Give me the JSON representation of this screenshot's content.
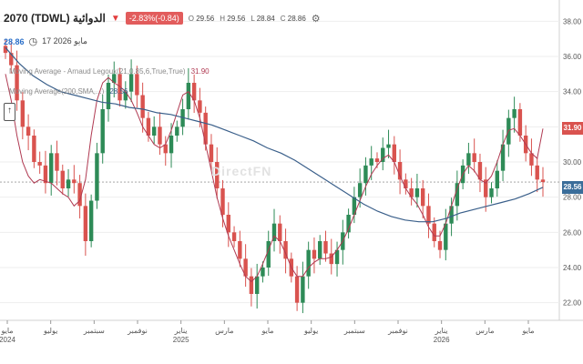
{
  "header": {
    "title": "2070 (TDWL) الدوائية",
    "change": "-2.83%(-0.84)",
    "ohlc": [
      {
        "key": "O",
        "value": "29.56"
      },
      {
        "key": "H",
        "value": "29.56"
      },
      {
        "key": "L",
        "value": "28.84"
      },
      {
        "key": "C",
        "value": "28.86"
      }
    ],
    "last_price": "28.86",
    "date": "17 2026 مايو"
  },
  "indicators": [
    {
      "label": "Moving Average - Arnaud Legoux(21,0.85,6,True,True)",
      "value": "31.90"
    },
    {
      "label": "Moving Average(200,SMA,...)",
      "value": "28.56"
    }
  ],
  "watermark": "DirectFN",
  "colors": {
    "up": "#2e8b57",
    "down": "#d9534f",
    "alma": "#b03a52",
    "sma": "#3a5f8a"
  },
  "chart_data": {
    "type": "candlestick",
    "title": "2070 (TDWL) الدوائية",
    "ylim": [
      21,
      39
    ],
    "y_ticks": [
      "22.00",
      "24.00",
      "26.00",
      "28.00",
      "30.00",
      "32.00",
      "34.00",
      "36.00",
      "38.00"
    ],
    "x_ticks": [
      "مايو 2024",
      "يوليو",
      "سبتمبر",
      "نوفمبر",
      "يناير 2025",
      "مارس",
      "مايو",
      "يوليو",
      "سبتمبر",
      "نوفمبر",
      "يناير 2026",
      "مارس",
      "مايو"
    ],
    "close_series": [
      36.2,
      35.5,
      33.5,
      32.0,
      31.5,
      30.0,
      29.8,
      28.8,
      30.5,
      29.5,
      28.5,
      29.0,
      28.8,
      27.5,
      25.5,
      27.8,
      30.5,
      33.0,
      34.5,
      35.0,
      33.5,
      34.0,
      35.0,
      33.8,
      32.5,
      31.5,
      32.0,
      31.0,
      30.5,
      31.5,
      32.0,
      33.0,
      34.5,
      33.5,
      32.8,
      31.0,
      30.0,
      28.5,
      27.0,
      26.0,
      25.5,
      24.5,
      23.5,
      22.5,
      23.5,
      24.0,
      25.5,
      26.5,
      25.5,
      24.5,
      23.5,
      22.0,
      23.5,
      25.0,
      24.5,
      25.5,
      24.8,
      24.2,
      25.0,
      26.0,
      27.0,
      28.0,
      28.8,
      29.8,
      30.2,
      30.0,
      30.8,
      31.0,
      30.0,
      29.0,
      28.5,
      28.0,
      28.5,
      27.5,
      26.5,
      25.5,
      25.0,
      26.5,
      27.5,
      28.8,
      29.8,
      30.5,
      30.0,
      29.0,
      28.0,
      28.5,
      29.5,
      31.0,
      32.5,
      33.0,
      31.5,
      30.5,
      29.8,
      29.0,
      28.86
    ],
    "alma_series": [
      35.0,
      33.5,
      31.5,
      30.0,
      29.2,
      28.8,
      29.0,
      28.9,
      28.8,
      28.5,
      28.2,
      28.0,
      27.5,
      27.8,
      29.0,
      31.5,
      33.5,
      34.5,
      34.8,
      34.5,
      34.3,
      34.0,
      33.5,
      32.8,
      32.0,
      31.5,
      31.0,
      30.8,
      31.0,
      31.8,
      32.8,
      33.8,
      34.0,
      33.5,
      32.5,
      31.0,
      29.5,
      28.0,
      26.8,
      25.8,
      25.0,
      24.2,
      23.5,
      23.2,
      23.5,
      24.2,
      25.0,
      25.8,
      25.5,
      24.8,
      24.0,
      23.5,
      23.5,
      24.0,
      24.3,
      24.5,
      24.5,
      24.6,
      25.0,
      25.5,
      26.2,
      27.0,
      27.8,
      28.6,
      29.3,
      29.8,
      30.2,
      30.4,
      30.0,
      29.2,
      28.5,
      28.0,
      27.6,
      27.0,
      26.3,
      25.8,
      25.8,
      26.5,
      27.5,
      28.5,
      29.3,
      29.8,
      29.5,
      29.0,
      28.8,
      29.2,
      30.0,
      31.0,
      31.8,
      31.9,
      31.5,
      31.0,
      30.5,
      30.2,
      31.9
    ],
    "sma_series": [
      36.5,
      35.6,
      34.9,
      34.4,
      34.0,
      33.8,
      33.6,
      33.4,
      33.3,
      33.1,
      33.0,
      32.8,
      32.7,
      32.5,
      32.3,
      32.1,
      31.8,
      31.5,
      31.2,
      30.8,
      30.5,
      30.1,
      29.6,
      29.1,
      28.6,
      28.1,
      27.6,
      27.2,
      26.9,
      26.7,
      26.6,
      26.6,
      26.8,
      27.1,
      27.3,
      27.5,
      27.7,
      27.9,
      28.2,
      28.56
    ]
  }
}
